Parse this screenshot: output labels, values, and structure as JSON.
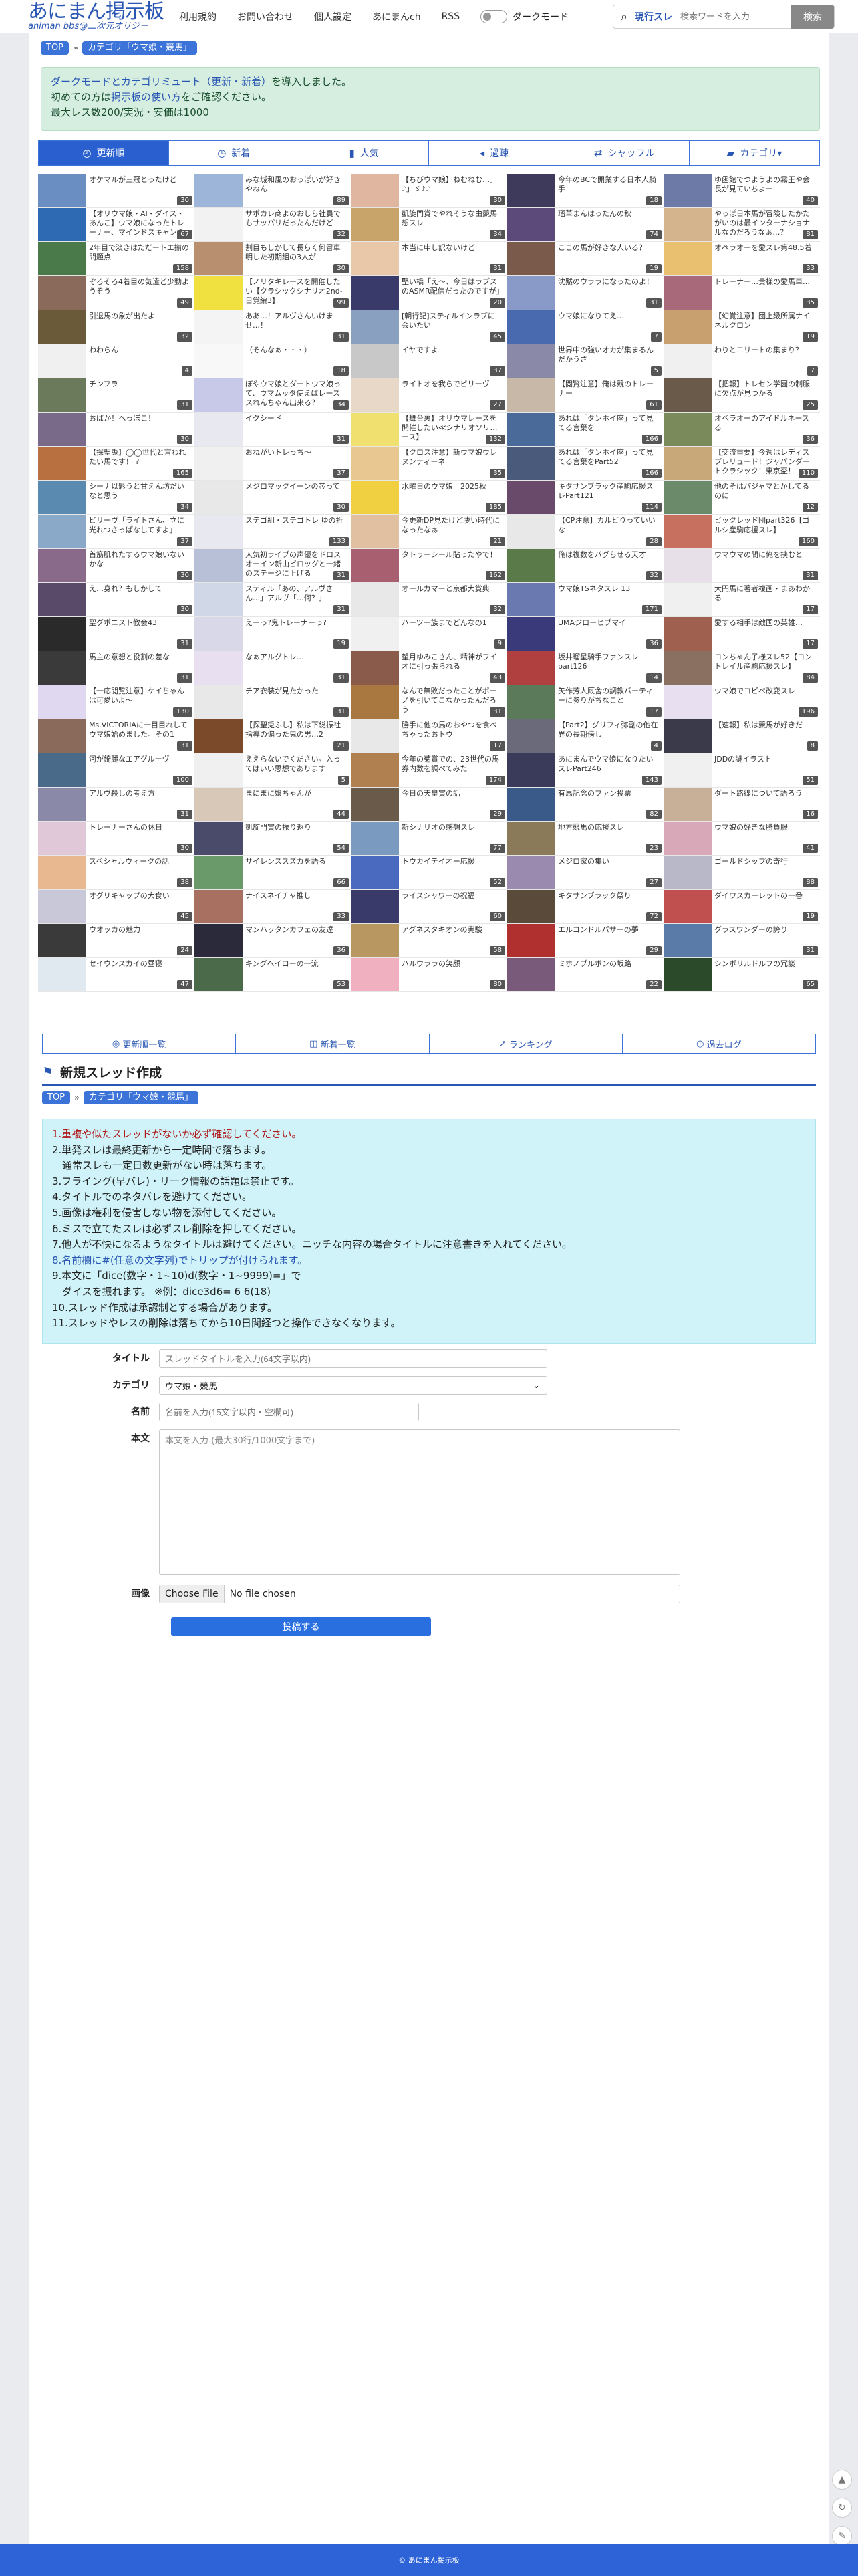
{
  "site": {
    "title": "あにまん掲示板",
    "subtitle": "animan bbs@二次元オリジー"
  },
  "nav": [
    "利用規約",
    "お問い合わせ",
    "個人設定",
    "あにまんch",
    "RSS"
  ],
  "dark_mode_label": "ダークモード",
  "search": {
    "scope": "現行スレ",
    "placeholder": "検索ワードを入力",
    "button": "検索"
  },
  "breadcrumb": {
    "top": "TOP",
    "category": "カテゴリ「ウマ娘・競馬」"
  },
  "notice": {
    "line1_link": "ダークモードとカテゴリミュート（更新・新着）",
    "line1_rest": "を導入しました。",
    "line2_pre": "初めての方は",
    "line2_link": "掲示板の使い方",
    "line2_post": "をご確認ください。",
    "line3": "最大レス数200/実況・安価は1000"
  },
  "tabs": [
    {
      "icon": "◴",
      "label": "更新順"
    },
    {
      "icon": "◷",
      "label": "新着"
    },
    {
      "icon": "▮",
      "label": "人気"
    },
    {
      "icon": "◂",
      "label": "過疎"
    },
    {
      "icon": "⇄",
      "label": "シャッフル"
    },
    {
      "icon": "▰",
      "label": "カテゴリ▾"
    }
  ],
  "threads": [
    {
      "t": "オケマルが三冠とったけど",
      "c": "30",
      "col": "#6a8ec2"
    },
    {
      "t": "みな城和風のおっぱいが好きやねん",
      "c": "89",
      "col": "#9db5d8"
    },
    {
      "t": "【ちびウマ娘】ねむねむ…」♪」ゞ♪♪",
      "c": "30",
      "col": "#e0b6a0"
    },
    {
      "t": "今年のBCで開業する日本人騎手",
      "c": "18",
      "col": "#3e3a5c"
    },
    {
      "t": "ゆ函館でつようよの霧王や会長が見ていちよー",
      "c": "40",
      "col": "#6d7aa8"
    },
    {
      "t": "【オリウマ娘・AI・ダイス・あんこ】ウマ娘になったトレーナー、マインドスキャンのスレ 最終レース",
      "c": "67",
      "col": "#2e6ab4"
    },
    {
      "t": "サポカレ商よのおしら社員でもサッパリだったんだけど",
      "c": "32",
      "col": "#f2f2f2"
    },
    {
      "t": "凱旋門賞でやれそうな由競馬想スレ",
      "c": "34",
      "col": "#c8a46a"
    },
    {
      "t": "瑠草まんはったんの秋",
      "c": "74",
      "col": "#5c4a7a"
    },
    {
      "t": "やっぱ日本馬が冒険したかたがいのは最インターナショナルなのだろうなぁ…？",
      "c": "81",
      "col": "#d4b48c"
    },
    {
      "t": "2年目で淡きはただートエ揃の問題点",
      "c": "158",
      "col": "#4a7a4a"
    },
    {
      "t": "割目もしかして長らく何冒車明した初期組の3人が",
      "c": "30",
      "col": "#b89070"
    },
    {
      "t": "本当に申し訳ないけど",
      "c": "31",
      "col": "#e8c8a8"
    },
    {
      "t": "ここの馬が好きな人いる？",
      "c": "19",
      "col": "#7a5a4a"
    },
    {
      "t": "オペラオーを愛スレ第48.5着",
      "c": "33",
      "col": "#e8c070"
    },
    {
      "t": "ぞろそろ4着目の気遣ど少動ようぞう",
      "c": "49",
      "col": "#8a6a5a"
    },
    {
      "t": "【ノリタキレースを開催したい【クラシックシナリオ2nd-日覚編3】",
      "c": "99",
      "col": "#f0e040"
    },
    {
      "t": "堅い橋「え～、今日はラブスのASMR配信だったのですが」",
      "c": "20",
      "col": "#3a3a6a"
    },
    {
      "t": "沈黙のウララになったのよ！",
      "c": "31",
      "col": "#8a9ac8"
    },
    {
      "t": "トレーナー…貴様の愛馬車…",
      "c": "35",
      "col": "#a86a7a"
    },
    {
      "t": "引退馬の象が出たよ",
      "c": "32",
      "col": "#6a5a3a"
    },
    {
      "t": "ああ…！アルヴさんいけませ…！",
      "c": "31",
      "col": "#f4f4f4"
    },
    {
      "t": "[朝行記]スティルインラブに会いたい",
      "c": "45",
      "col": "#8aa0c0"
    },
    {
      "t": "ウマ娘になりてえ…",
      "c": "7",
      "col": "#4a6ab0"
    },
    {
      "t": "【幻覚注意】団上級所属ナイネルクロン",
      "c": "19",
      "col": "#c8a070"
    },
    {
      "t": "わわらん",
      "c": "4",
      "col": "#f0f0f0"
    },
    {
      "t": "（そんなぁ・・・）",
      "c": "18",
      "col": "#f8f8f8"
    },
    {
      "t": "イヤですよ",
      "c": "37",
      "col": "#c8c8c8"
    },
    {
      "t": "世界中の強いオカが集まるんだかうさ",
      "c": "5",
      "col": "#8a8aa8"
    },
    {
      "t": "わりとエリートの集まり？",
      "c": "7",
      "col": "#f0f0f0"
    },
    {
      "t": "チンフラ",
      "c": "31",
      "col": "#6a7a5a"
    },
    {
      "t": "ぼやウマ娘とダートウマ娘って、ウマムッタ使えばレーススれんちゃん出来る？",
      "c": "34",
      "col": "#c8c8e8"
    },
    {
      "t": "ライトオを我らでビリーヴ",
      "c": "27",
      "col": "#e8d8c8"
    },
    {
      "t": "【閲覧注意】俺は競のトレーナー",
      "c": "61",
      "col": "#c8b8a8"
    },
    {
      "t": "【把報】トレセン学園の制服に欠点が見つかる",
      "c": "25",
      "col": "#6a5a4a"
    },
    {
      "t": "おばか！へっぽこ！",
      "c": "30",
      "col": "#7a6a8a"
    },
    {
      "t": "イクシード",
      "c": "31",
      "col": "#e8e8f0"
    },
    {
      "t": "【舞台裏】オリウマレースを開催したい≪シナリオソリ…ース】",
      "c": "132",
      "col": "#f0e070"
    },
    {
      "t": "あれは「タンホイ座」って見てる言葉を",
      "c": "166",
      "col": "#4a6a9a"
    },
    {
      "t": "オペラオーのアイドルネースる",
      "c": "36",
      "col": "#7a8a5a"
    },
    {
      "t": "【探聖兎】◯◯世代と言われたい馬です！ ?",
      "c": "165",
      "col": "#b87040"
    },
    {
      "t": "おねがいトレっち～",
      "c": "37",
      "col": "#f0f0f0"
    },
    {
      "t": "【クロス注意】新ウマ娘ウレヌンティーネ",
      "c": "35",
      "col": "#e8c890"
    },
    {
      "t": "あれは「タンホイ座」って見てる言葉をPart52",
      "c": "166",
      "col": "#4a5a7a"
    },
    {
      "t": "【交流重要】今週はレディスプレリュード！ジャパンダートクラシック！東京盃！",
      "c": "110",
      "col": "#c8a878"
    },
    {
      "t": "シーナ以影うと甘えん坊だいなと思う",
      "c": "34",
      "col": "#5a8ab0"
    },
    {
      "t": "メジロマックイーンの芯って",
      "c": "30",
      "col": "#e8e8e8"
    },
    {
      "t": "水曜日のウマ娘　2025秋",
      "c": "185",
      "col": "#f0d040"
    },
    {
      "t": "キタサンブラック産駒応援スレPart121",
      "c": "114",
      "col": "#6a4a6a"
    },
    {
      "t": "他のそはパジャマとかしてるのに",
      "c": "12",
      "col": "#6a8a6a"
    },
    {
      "t": "ビリーヴ「ライトさん、立に光れつさっぱなしてすよ」",
      "c": "37",
      "col": "#8aa8c8"
    },
    {
      "t": "ステゴ組・ステゴトレ ゆの折",
      "c": "133",
      "col": "#e8e8f0"
    },
    {
      "t": "今更新DP見たけど凄い時代になったなぁ",
      "c": "21",
      "col": "#e0c0a0"
    },
    {
      "t": "【CP注意】カルビりっていいな",
      "c": "28",
      "col": "#e8e8e8"
    },
    {
      "t": "ビックレッド団part326【ゴルシ産駒応援スレ】",
      "c": "160",
      "col": "#c87060"
    },
    {
      "t": "首筋肌れたするウマ娘いないかな",
      "c": "30",
      "col": "#8a6a8a"
    },
    {
      "t": "人気初ライブの声優をドロスオーイン新山ビロッグと一緒のステージに上げる",
      "c": "31",
      "col": "#b8c0d8"
    },
    {
      "t": "タトゥーシール貼ったやで！",
      "c": "162",
      "col": "#a86070"
    },
    {
      "t": "俺は複数をバグらせる天才",
      "c": "32",
      "col": "#5a7a4a"
    },
    {
      "t": "ウマウマの間に俺を挟むと",
      "c": "31",
      "col": "#e8e0e8"
    },
    {
      "t": "え…身れ？もしかして",
      "c": "30",
      "col": "#5a4a6a"
    },
    {
      "t": "スティル「あの、アルヴさん…」アルヴ「…何？」",
      "c": "31",
      "col": "#d0d8e8"
    },
    {
      "t": "オールカマーと京都大賞典",
      "c": "32",
      "col": "#e8e8e8"
    },
    {
      "t": "ウマ娘TSネタスレ 13",
      "c": "171",
      "col": "#6a7ab0"
    },
    {
      "t": "大円馬に著者複画・まあわかる",
      "c": "17",
      "col": "#f0f0f0"
    },
    {
      "t": "聖グポニスト教会43",
      "c": "31",
      "col": "#2a2a2a"
    },
    {
      "t": "えーっ?鬼トレーナーっ?",
      "c": "19",
      "col": "#d8d8e8"
    },
    {
      "t": "ハーツー族までどんなの1",
      "c": "9",
      "col": "#f0f0f0"
    },
    {
      "t": "UMAジローヒブマイ",
      "c": "36",
      "col": "#3a3a7a"
    },
    {
      "t": "愛する相手は敵国の英雄…",
      "c": "17",
      "col": "#a06050"
    },
    {
      "t": "馬主の意想と役割の差な",
      "c": "31",
      "col": "#3a3a3a"
    },
    {
      "t": "なぁアルグトレ…",
      "c": "31",
      "col": "#e8e0f0"
    },
    {
      "t": "望月ゆみこさん、精神がフイオに引っ張られる",
      "c": "43",
      "col": "#8a5a4a"
    },
    {
      "t": "坂井瑠星騎手ファンスレpart126",
      "c": "14",
      "col": "#b04040"
    },
    {
      "t": "コンちゃん子様スレ52【コントレイル産駒応援スレ】",
      "c": "84",
      "col": "#8a7060"
    },
    {
      "t": "【一応閲覧注意】ケイちゃんは可愛いよ～",
      "c": "130",
      "col": "#e0d8f0"
    },
    {
      "t": "チア衣装が見たかった",
      "c": "31",
      "col": "#e8e8e8"
    },
    {
      "t": "なんで無敗だったことがボーノを引いてこなかったんだろう",
      "c": "31",
      "col": "#a87840"
    },
    {
      "t": "矢作芳人厩舎の調教パーティーに参りがちなこと",
      "c": "17",
      "col": "#5a7a5a"
    },
    {
      "t": "ウマ娘でコピペ改変スレ",
      "c": "196",
      "col": "#e8e0f0"
    },
    {
      "t": "Ms.VICTORIAに一目目れしてウマ娘始めました。その1",
      "c": "31",
      "col": "#8a6a5a"
    },
    {
      "t": "【探聖兎ふし】私は下総振社指導の偏った鬼の男…2",
      "c": "21",
      "col": "#7a4a2a"
    },
    {
      "t": "勝手に他の馬のおやつを食べちゃったおトウ",
      "c": "17",
      "col": "#e8e8e8"
    },
    {
      "t": "【Part2】グリフィ弥副の他在界の長期傍し",
      "c": "4",
      "col": "#6a6a7a"
    },
    {
      "t": "【速報】私は競馬が好きだ",
      "c": "8",
      "col": "#3a3a4a"
    },
    {
      "t": "河が綺麗なエアグルーヴ",
      "c": "100",
      "col": "#4a6a8a"
    },
    {
      "t": "ええらないでください。入ってはいい思想であります",
      "c": "5",
      "col": "#f0f0f0"
    },
    {
      "t": "今年の菊賞での、23世代の馬券内数を調べてみた",
      "c": "174",
      "col": "#b08050"
    },
    {
      "t": "あにまんでウマ娘になりたいスレPart246",
      "c": "143",
      "col": "#3a3a5a"
    },
    {
      "t": "JDDの謎イラスト",
      "c": "51",
      "col": "#f0f0f0"
    },
    {
      "t": "アルヴ殺しの考え方",
      "c": "31",
      "col": "#8a8aa8"
    },
    {
      "t": "まにまに嬢ちゃんが",
      "c": "44",
      "col": "#d8c8b8"
    },
    {
      "t": "今日の天皇賞の話",
      "c": "29",
      "col": "#6a5a4a"
    },
    {
      "t": "有馬記念のファン投票",
      "c": "82",
      "col": "#3a5a8a"
    },
    {
      "t": "ダート路線について語ろう",
      "c": "16",
      "col": "#c8b098"
    },
    {
      "t": "トレーナーさんの休日",
      "c": "30",
      "col": "#e0c8d8"
    },
    {
      "t": "凱旋門賞の振り返り",
      "c": "54",
      "col": "#4a4a6a"
    },
    {
      "t": "新シナリオの感想スレ",
      "c": "77",
      "col": "#7a9ac0"
    },
    {
      "t": "地方競馬の応援スレ",
      "c": "23",
      "col": "#8a7a5a"
    },
    {
      "t": "ウマ娘の好きな勝負服",
      "c": "41",
      "col": "#d8a8b8"
    },
    {
      "t": "スペシャルウィークの話",
      "c": "38",
      "col": "#e8b890"
    },
    {
      "t": "サイレンススズカを語る",
      "c": "66",
      "col": "#6a9a6a"
    },
    {
      "t": "トウカイテイオー応援",
      "c": "52",
      "col": "#4a6ac0"
    },
    {
      "t": "メジロ家の集い",
      "c": "27",
      "col": "#9a8ab0"
    },
    {
      "t": "ゴールドシップの奇行",
      "c": "88",
      "col": "#b8b8c8"
    },
    {
      "t": "オグリキャップの大食い",
      "c": "45",
      "col": "#c8c8d8"
    },
    {
      "t": "ナイスネイチャ推し",
      "c": "33",
      "col": "#a87060"
    },
    {
      "t": "ライスシャワーの祝福",
      "c": "60",
      "col": "#3a3a6a"
    },
    {
      "t": "キタサンブラック祭り",
      "c": "72",
      "col": "#5a4a3a"
    },
    {
      "t": "ダイワスカーレットの一番",
      "c": "19",
      "col": "#c05050"
    },
    {
      "t": "ウオッカの魅力",
      "c": "24",
      "col": "#3a3a3a"
    },
    {
      "t": "マンハッタンカフェの友達",
      "c": "36",
      "col": "#2a2a3a"
    },
    {
      "t": "アグネスタキオンの実験",
      "c": "58",
      "col": "#b89860"
    },
    {
      "t": "エルコンドルパサーの夢",
      "c": "29",
      "col": "#b03030"
    },
    {
      "t": "グラスワンダーの誇り",
      "c": "31",
      "col": "#5a7aa8"
    },
    {
      "t": "セイウンスカイの昼寝",
      "c": "47",
      "col": "#e0e8f0"
    },
    {
      "t": "キングヘイローの一流",
      "c": "53",
      "col": "#4a6a4a"
    },
    {
      "t": "ハルウララの笑顔",
      "c": "80",
      "col": "#f0b0c0"
    },
    {
      "t": "ミホノブルボンの坂路",
      "c": "22",
      "col": "#7a5a7a"
    },
    {
      "t": "シンボリルドルフの冗談",
      "c": "65",
      "col": "#2a4a2a"
    }
  ],
  "footnav": [
    {
      "icon": "◎",
      "label": "更新順一覧"
    },
    {
      "icon": "◫",
      "label": "新着一覧"
    },
    {
      "icon": "↗",
      "label": "ランキング"
    },
    {
      "icon": "◷",
      "label": "過去ログ"
    }
  ],
  "new_thread": {
    "icon": "⚑",
    "title": "新規スレッド作成"
  },
  "rules": [
    {
      "text": "1.重複や似たスレッドがないか必ず確認してください。",
      "style": "red"
    },
    {
      "text": "2.単発スレは最終更新から一定時間で落ちます。",
      "style": ""
    },
    {
      "text": "　通常スレも一定日数更新がない時は落ちます。",
      "style": ""
    },
    {
      "text": "3.フライング(早バレ)・リーク情報の話題は禁止です。",
      "style": ""
    },
    {
      "text": "4.タイトルでのネタバレを避けてください。",
      "style": ""
    },
    {
      "text": "5.画像は権利を侵害しない物を添付してください。",
      "style": ""
    },
    {
      "text": "6.ミスで立てたスレは必ずスレ削除を押してください。",
      "style": ""
    },
    {
      "text": "7.他人が不快になるようなタイトルは避けてください。ニッチな内容の場合タイトルに注意書きを入れてください。",
      "style": ""
    },
    {
      "text": "8.名前欄に#(任意の文字列)でトリップが付けられます。",
      "style": "blue"
    },
    {
      "text": "9.本文に「dice(数字・1~10)d(数字・1~9999)=」で",
      "style": ""
    },
    {
      "text": "　ダイスを振れます。 ※例：dice3d6= 6 6(18)",
      "style": ""
    },
    {
      "text": "10.スレッド作成は承認制とする場合があります。",
      "style": ""
    },
    {
      "text": "11.スレッドやレスの削除は落ちてから10日間経つと操作できなくなります。",
      "style": ""
    }
  ],
  "form": {
    "title_label": "タイトル",
    "title_placeholder": "スレッドタイトルを入力(64文字以内)",
    "category_label": "カテゴリ",
    "category_value": "ウマ娘・競馬",
    "name_label": "名前",
    "name_placeholder": "名前を入力(15文字以内・空欄可)",
    "body_label": "本文",
    "body_placeholder": "本文を入力 (最大30行/1000文字まで)",
    "image_label": "画像",
    "file_button": "Choose File",
    "file_status": "No file chosen",
    "submit": "投稿する"
  },
  "footer_text": "© あにまん掲示板"
}
